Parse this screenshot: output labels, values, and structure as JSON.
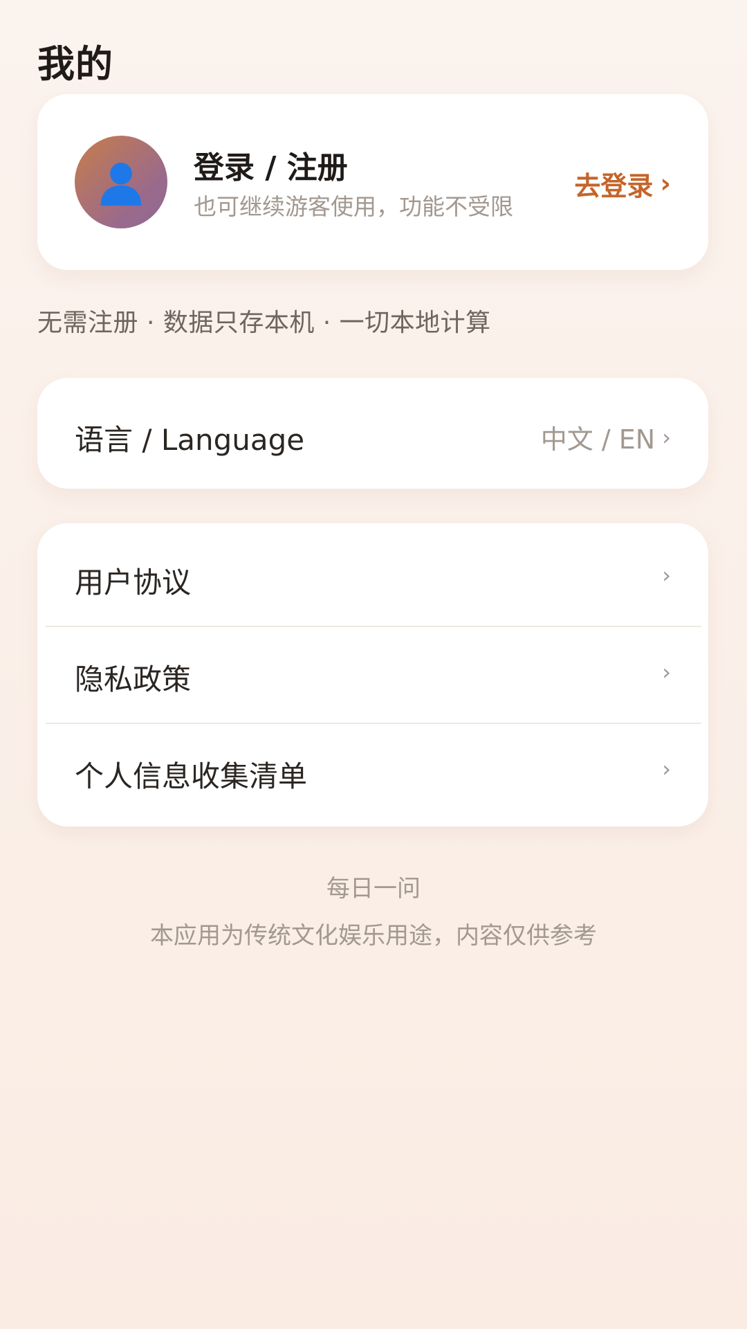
{
  "page": {
    "title": "我的"
  },
  "profile": {
    "title": "登录 / 注册",
    "subtitle": "也可继续游客使用，功能不受限",
    "login_label": "去登录",
    "login_chevron": "›",
    "avatar_icon": "user-icon"
  },
  "tagline": "无需注册 · 数据只存本机 · 一切本地计算",
  "language": {
    "label": "语言 / Language",
    "value": "中文 / EN",
    "chevron": "›"
  },
  "menu": {
    "items": [
      {
        "label": "用户协议",
        "chevron": "›"
      },
      {
        "label": "隐私政策",
        "chevron": "›"
      },
      {
        "label": "个人信息收集清单",
        "chevron": "›"
      }
    ]
  },
  "footer": {
    "app_name": "每日一问",
    "disclaimer": "本应用为传统文化娱乐用途，内容仅供参考"
  },
  "colors": {
    "accent": "#c4652a",
    "muted_text": "#a29890",
    "background": "#fbf3ee",
    "card": "#ffffff"
  }
}
